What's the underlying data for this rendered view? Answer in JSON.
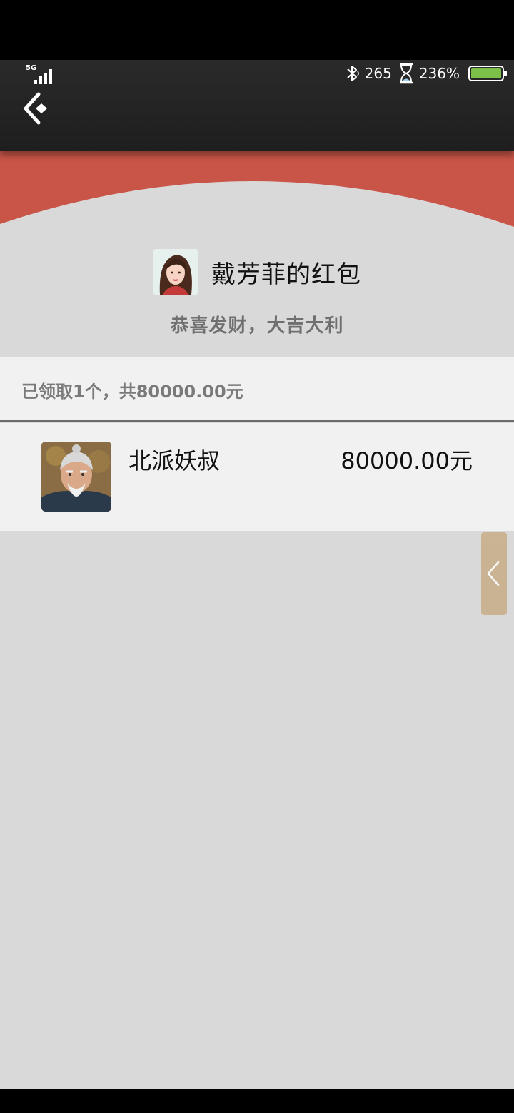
{
  "status_bar": {
    "network": "5G",
    "bluetooth_icon": "bluetooth-icon",
    "data_speed": "265",
    "hourglass_icon": "hourglass-icon",
    "battery_percent": "236%",
    "battery_color": "#7cc04a"
  },
  "header": {
    "back_icon": "back-chevron-icon"
  },
  "red_packet": {
    "accent_color": "#c85548",
    "sender_name": "戴芳菲的红包",
    "wish": "恭喜发财，大吉大利",
    "summary": "已领取1个，共80000.00元"
  },
  "records": [
    {
      "name": "北派妖叔",
      "amount": "80000.00元"
    }
  ],
  "side_handle": {
    "icon": "chevron-left-icon"
  }
}
